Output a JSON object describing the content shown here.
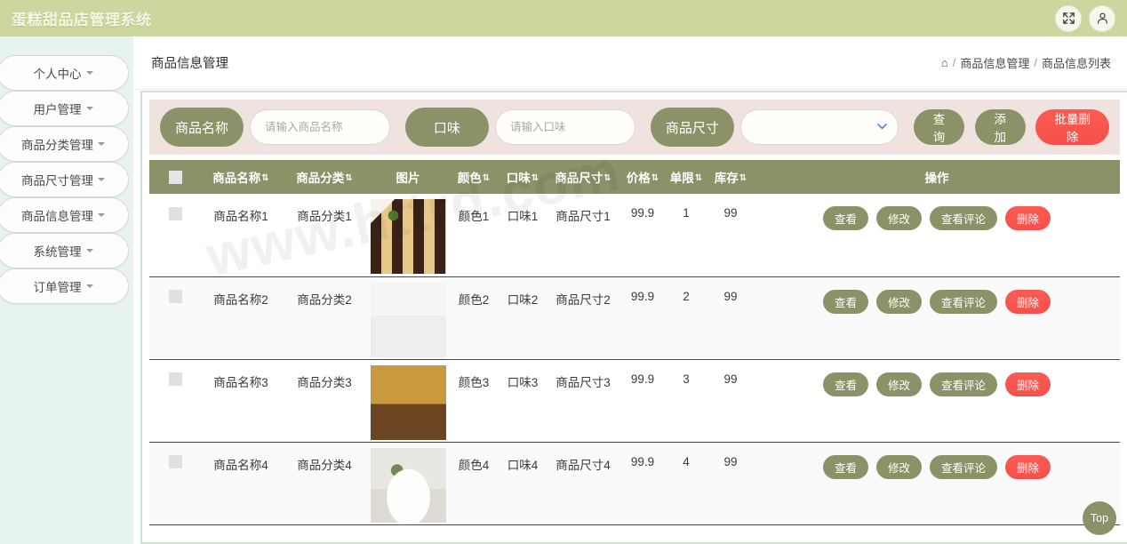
{
  "app": {
    "title": "蛋糕甜品店管理系统",
    "header_buttons": [
      {
        "name": "fullscreen-icon",
        "label": ""
      },
      {
        "name": "user-icon",
        "label": ""
      }
    ]
  },
  "sidebar": {
    "items": [
      {
        "label": "个人中心"
      },
      {
        "label": "用户管理"
      },
      {
        "label": "商品分类管理"
      },
      {
        "label": "商品尺寸管理"
      },
      {
        "label": "商品信息管理"
      },
      {
        "label": "系统管理"
      },
      {
        "label": "订单管理"
      }
    ]
  },
  "breadcrumb": {
    "page_title": "商品信息管理",
    "home_icon": "⌂",
    "sep": "/",
    "crumbs": [
      "商品信息管理",
      "商品信息列表"
    ]
  },
  "search": {
    "name_label": "商品名称",
    "name_placeholder": "请输入商品名称",
    "name_value": "",
    "flavor_label": "口味",
    "flavor_placeholder": "请输入口味",
    "flavor_value": "",
    "size_label": "商品尺寸",
    "size_value": "",
    "size_options": [
      ""
    ],
    "query_btn": "查询",
    "add_btn": "添加",
    "batch_delete_btn": "批量删除"
  },
  "table": {
    "headers": [
      {
        "label": "",
        "sortable": false
      },
      {
        "label": "商品名称",
        "sortable": true
      },
      {
        "label": "商品分类",
        "sortable": true
      },
      {
        "label": "图片",
        "sortable": false
      },
      {
        "label": "颜色",
        "sortable": true
      },
      {
        "label": "口味",
        "sortable": true
      },
      {
        "label": "商品尺寸",
        "sortable": true
      },
      {
        "label": "价格",
        "sortable": true
      },
      {
        "label": "单限",
        "sortable": true
      },
      {
        "label": "库存",
        "sortable": true
      },
      {
        "label": "操作",
        "sortable": false
      }
    ],
    "sort_glyph": "⇅",
    "row_actions": {
      "view": "查看",
      "edit": "修改",
      "comments": "查看评论",
      "delete": "删除"
    },
    "rows": [
      {
        "name": "商品名称1",
        "category": "商品分类1",
        "color": "颜色1",
        "flavor": "口味1",
        "size": "商品尺寸1",
        "price": "99.9",
        "limit": "1",
        "stock": "99",
        "image_alt": "chocolate-checkerboard-cake-slice"
      },
      {
        "name": "商品名称2",
        "category": "商品分类2",
        "color": "颜色2",
        "flavor": "口味2",
        "size": "商品尺寸2",
        "price": "99.9",
        "limit": "2",
        "stock": "99",
        "image_alt": "white-cake-with-gold-drip"
      },
      {
        "name": "商品名称3",
        "category": "商品分类3",
        "color": "颜色3",
        "flavor": "口味3",
        "size": "商品尺寸3",
        "price": "99.9",
        "limit": "3",
        "stock": "99",
        "image_alt": "chocolate-layer-cake-slice"
      },
      {
        "name": "商品名称4",
        "category": "商品分类4",
        "color": "颜色4",
        "flavor": "口味4",
        "size": "商品尺寸4",
        "price": "99.9",
        "limit": "4",
        "stock": "99",
        "image_alt": "white-floral-cake"
      }
    ]
  },
  "watermark": {
    "text": "www.httrd.com"
  },
  "scroll_top": {
    "label": "Top"
  },
  "colors": {
    "header_bg": "#ccd79f",
    "accent": "#8b9268",
    "danger": "#f7504b",
    "sidebar_bg": "#e6f3ef",
    "searchbar_bg": "#f0e2de",
    "panel_border": "#cfe0cb"
  }
}
